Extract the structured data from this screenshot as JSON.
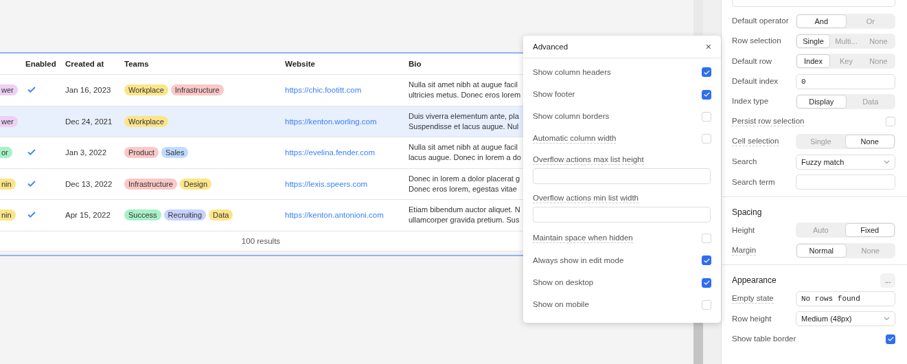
{
  "table": {
    "columns": [
      "Enabled",
      "Created at",
      "Teams",
      "Website",
      "Bio"
    ],
    "rows": [
      {
        "role": {
          "text": "wer",
          "color": "#ecd0f5"
        },
        "enabled": true,
        "created": "Jan 16, 2023",
        "teams": [
          {
            "name": "Workplace",
            "color": "#fce588"
          },
          {
            "name": "Infrastructure",
            "color": "#fbc7c7"
          }
        ],
        "website": "https://chic.footitt.com",
        "bio": "Nulla sit amet nibh at augue facil\nultricies metus. Donec eros lorem",
        "selected": false
      },
      {
        "role": {
          "text": "wer",
          "color": "#ecd0f5"
        },
        "enabled": false,
        "created": "Dec 24, 2021",
        "teams": [
          {
            "name": "Workplace",
            "color": "#fce588"
          }
        ],
        "website": "https://kenton.worling.com",
        "bio": "Duis viverra elementum ante, pla\nSuspendisse et lacus augue. Nul",
        "selected": true
      },
      {
        "role": {
          "text": "or",
          "color": "#a7f0c8"
        },
        "enabled": true,
        "created": "Jan 3, 2022",
        "teams": [
          {
            "name": "Product",
            "color": "#fbc7c7"
          },
          {
            "name": "Sales",
            "color": "#bfdbfe"
          }
        ],
        "website": "https://evelina.fender.com",
        "bio": "Nulla sit amet nibh at augue facil\nlacus augue. Donec in lorem a do",
        "selected": false
      },
      {
        "role": {
          "text": "nin",
          "color": "#fce588"
        },
        "enabled": true,
        "created": "Dec 13, 2022",
        "teams": [
          {
            "name": "Infrastructure",
            "color": "#fbc7c7"
          },
          {
            "name": "Design",
            "color": "#fce588"
          }
        ],
        "website": "https://lexis.speers.com",
        "bio": "Donec in lorem a dolor placerat g\nDonec eros lorem, egestas vitae",
        "selected": false
      },
      {
        "role": {
          "text": "nin",
          "color": "#fce588"
        },
        "enabled": true,
        "created": "Apr 15, 2022",
        "teams": [
          {
            "name": "Success",
            "color": "#a7f0c8"
          },
          {
            "name": "Recruiting",
            "color": "#c7d2fe"
          },
          {
            "name": "Data",
            "color": "#fce588"
          }
        ],
        "website": "https://kenton.antonioni.com",
        "bio": "Etiam bibendum auctor aliquet. N\nullamcorper gravida pretium. Sus",
        "selected": false
      }
    ],
    "footer": "100 results"
  },
  "popover": {
    "title": "Advanced",
    "close": "×",
    "items": [
      {
        "kind": "checkbox",
        "label": "Show column headers",
        "help": false,
        "checked": true
      },
      {
        "kind": "checkbox",
        "label": "Show footer",
        "help": false,
        "checked": true
      },
      {
        "kind": "checkbox",
        "label": "Show column borders",
        "help": false,
        "checked": false
      },
      {
        "kind": "checkbox",
        "label": "Automatic column width",
        "help": true,
        "checked": false
      },
      {
        "kind": "input",
        "label": "Overflow actions max list height",
        "help": true
      },
      {
        "kind": "input",
        "label": "Overflow actions min list width",
        "help": true
      },
      {
        "kind": "checkbox",
        "label": "Maintain space when hidden",
        "help": true,
        "checked": false
      },
      {
        "kind": "checkbox",
        "label": "Always show in edit mode",
        "help": false,
        "checked": true
      },
      {
        "kind": "checkbox",
        "label": "Show on desktop",
        "help": false,
        "checked": true
      },
      {
        "kind": "checkbox",
        "label": "Show on mobile",
        "help": false,
        "checked": false
      }
    ]
  },
  "panel": {
    "sections": [
      {
        "rows": [
          {
            "kind": "segmented",
            "label": "Default operator",
            "help": false,
            "options": [
              {
                "label": "And",
                "selected": true
              },
              {
                "label": "Or",
                "selected": false
              }
            ]
          },
          {
            "kind": "segmented",
            "label": "Row selection",
            "help": false,
            "options": [
              {
                "label": "Single",
                "selected": true
              },
              {
                "label": "Multi...",
                "selected": false
              },
              {
                "label": "None",
                "selected": false
              }
            ]
          },
          {
            "kind": "segmented",
            "label": "Default row",
            "help": false,
            "options": [
              {
                "label": "Index",
                "selected": true
              },
              {
                "label": "Key",
                "selected": false
              },
              {
                "label": "None",
                "selected": false
              }
            ]
          },
          {
            "kind": "code",
            "label": "Default index",
            "help": false,
            "value": "0"
          },
          {
            "kind": "segmented",
            "label": "Index type",
            "help": false,
            "options": [
              {
                "label": "Display",
                "selected": true
              },
              {
                "label": "Data",
                "selected": false
              }
            ]
          },
          {
            "kind": "checkbox",
            "label": "Persist row selection",
            "help": true,
            "checked": false
          },
          {
            "kind": "segmented",
            "label": "Cell selection",
            "help": true,
            "options": [
              {
                "label": "Single",
                "selected": false
              },
              {
                "label": "None",
                "selected": true
              }
            ]
          },
          {
            "kind": "select",
            "label": "Search",
            "help": false,
            "value": "Fuzzy match"
          },
          {
            "kind": "input",
            "label": "Search term",
            "help": false
          }
        ]
      },
      {
        "title": "Spacing",
        "rows": [
          {
            "kind": "segmented",
            "label": "Height",
            "help": false,
            "options": [
              {
                "label": "Auto",
                "selected": false
              },
              {
                "label": "Fixed",
                "selected": true
              }
            ]
          },
          {
            "kind": "segmented",
            "label": "Margin",
            "help": true,
            "options": [
              {
                "label": "Normal",
                "selected": true
              },
              {
                "label": "None",
                "selected": false
              }
            ]
          }
        ]
      },
      {
        "title": "Appearance",
        "more": "...",
        "rows": [
          {
            "kind": "code",
            "label": "Empty state",
            "help": true,
            "value": "No rows found"
          },
          {
            "kind": "select",
            "label": "Row height",
            "help": false,
            "value": "Medium (48px)"
          },
          {
            "kind": "checkbox",
            "label": "Show table border",
            "help": false,
            "checked": true
          }
        ]
      }
    ]
  }
}
